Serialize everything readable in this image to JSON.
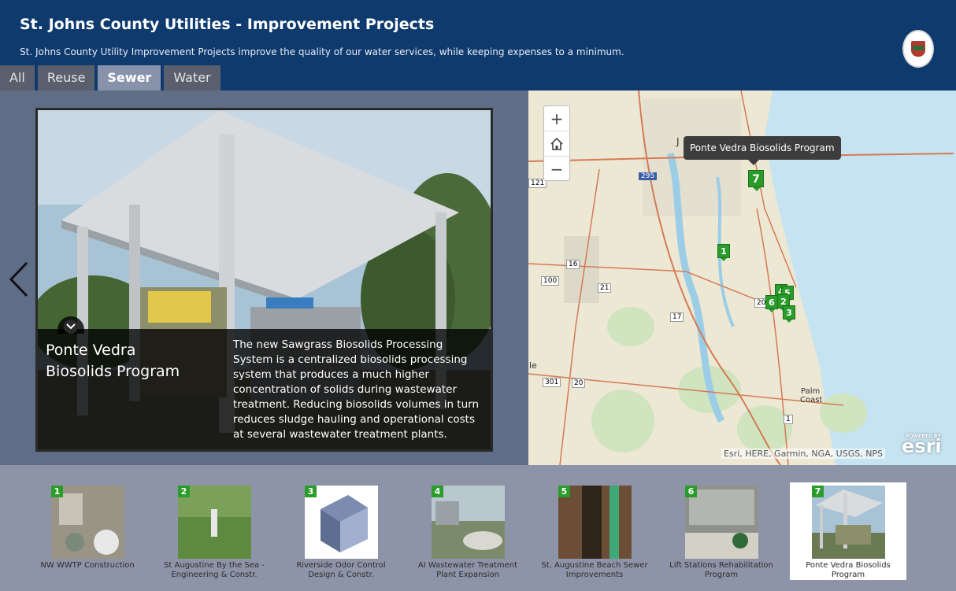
{
  "header": {
    "title": "St. Johns County Utilities - Improvement Projects",
    "subtitle": "St. Johns County Utility Improvement Projects improve the quality of our water services, while keeping expenses to a minimum.",
    "logo_icon": "county-seal-icon"
  },
  "tabs": [
    {
      "label": "All",
      "active": false
    },
    {
      "label": "Reuse",
      "active": false
    },
    {
      "label": "Sewer",
      "active": true
    },
    {
      "label": "Water",
      "active": false
    }
  ],
  "feature": {
    "title": "Ponte Vedra Biosolids Program",
    "description": "The new Sawgrass Biosolids Processing System is a centralized biosolids processing system that produces a much higher concentration of solids during wastewater treatment. Reducing biosolids volumes in turn reduces sludge hauling and operational costs at several wastewater treatment plants."
  },
  "map": {
    "zoom_in": "+",
    "home_icon": "home-icon",
    "zoom_out": "−",
    "tooltip": "Ponte Vedra Biosolids Program",
    "attribution": "Esri, HERE, Garmin, NGA, USGS, NPS",
    "powered_by": "POWERED BY",
    "esri_logo": "esri",
    "place_labels": [
      "J",
      "Palm",
      "Coast",
      "le"
    ],
    "road_shields": [
      "121",
      "295",
      "16",
      "100",
      "21",
      "17",
      "20",
      "301",
      "20",
      "1"
    ],
    "markers": [
      "7",
      "1",
      "4",
      "5",
      "6",
      "2",
      "3"
    ]
  },
  "thumbnails": [
    {
      "num": "1",
      "label": "NW WWTP Construction"
    },
    {
      "num": "2",
      "label": "St Augustine By the Sea - Engineering & Constr."
    },
    {
      "num": "3",
      "label": "Riverside Odor Control Design & Constr."
    },
    {
      "num": "4",
      "label": "AI Wastewater Treatment Plant Expansion"
    },
    {
      "num": "5",
      "label": "St. Augustine Beach Sewer Improvements"
    },
    {
      "num": "6",
      "label": "Lift Stations Rehabilitation Program"
    },
    {
      "num": "7",
      "label": "Ponte Vedra Biosolids Program",
      "active": true
    }
  ],
  "colors": {
    "header": "#0f3a6e",
    "marker": "#2a9c2a",
    "active_tab": "#8893ab"
  }
}
